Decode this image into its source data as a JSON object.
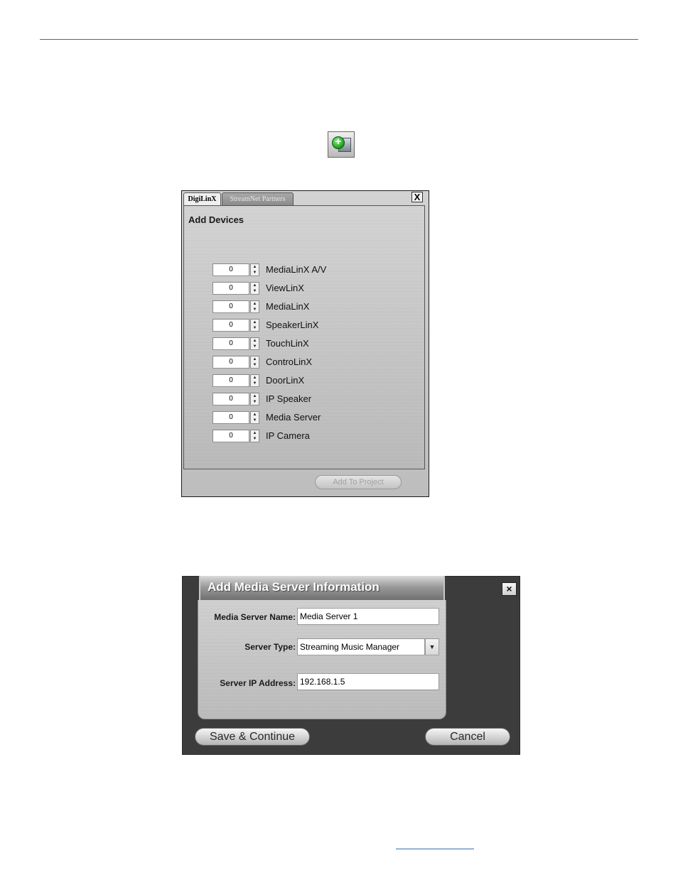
{
  "icon": {
    "name": "add-device-icon"
  },
  "devices_dialog": {
    "tabs": [
      {
        "label": "DigiLinX"
      },
      {
        "label": "StreamNet Partners"
      }
    ],
    "close_label": "X",
    "title": "Add Devices",
    "devices": [
      {
        "quantity": "0",
        "name": "MediaLinX A/V"
      },
      {
        "quantity": "0",
        "name": "ViewLinX"
      },
      {
        "quantity": "0",
        "name": "MediaLinX"
      },
      {
        "quantity": "0",
        "name": "SpeakerLinX"
      },
      {
        "quantity": "0",
        "name": "TouchLinX"
      },
      {
        "quantity": "0",
        "name": "ControLinX"
      },
      {
        "quantity": "0",
        "name": "DoorLinX"
      },
      {
        "quantity": "0",
        "name": "IP Speaker"
      },
      {
        "quantity": "0",
        "name": "Media Server"
      },
      {
        "quantity": "0",
        "name": "IP Camera"
      }
    ],
    "add_button": "Add To Project"
  },
  "media_server_dialog": {
    "title": "Add Media Server Information",
    "close_label": "×",
    "fields": {
      "name_label": "Media Server Name:",
      "name_value": "Media Server 1",
      "type_label": "Server Type:",
      "type_value": "Streaming Music Manager",
      "ip_label": "Server IP Address:",
      "ip_value": "192.168.1.5"
    },
    "save_button": "Save & Continue",
    "cancel_button": "Cancel"
  }
}
